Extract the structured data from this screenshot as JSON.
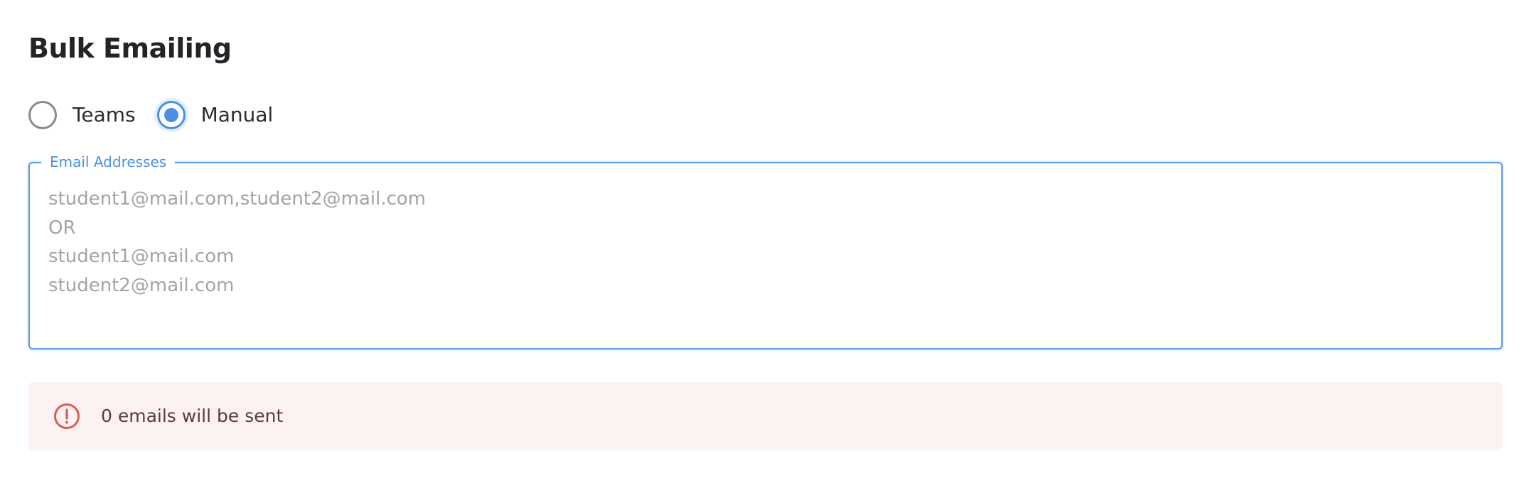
{
  "page": {
    "title": "Bulk Emailing"
  },
  "recipient_mode": {
    "options": [
      {
        "label": "Teams",
        "selected": false
      },
      {
        "label": "Manual",
        "selected": true
      }
    ],
    "accent_color": "#4a90e2",
    "unselected_color": "#8a8a8a"
  },
  "email_field": {
    "label": "Email Addresses",
    "value": "",
    "placeholder": "student1@mail.com,student2@mail.com\nOR\nstudent1@mail.com\nstudent2@mail.com"
  },
  "alert": {
    "icon": "alert-circle-icon",
    "message": "0 emails will be sent",
    "severity_color": "#e05a55",
    "background": "#fdf2f2"
  }
}
